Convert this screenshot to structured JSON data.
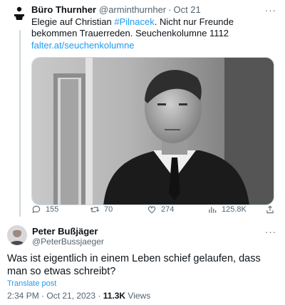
{
  "quoted_tweet": {
    "author_name": "Büro Thurnher",
    "handle": "@arminthurnher",
    "separator": "·",
    "time": "Oct 21",
    "more_label": "···",
    "text_before": "Elegie auf Christian ",
    "hashtag": "#Pilnacek",
    "text_after": ". Nicht nur Freunde bekommen Trauerreden. Seuchenkolumne 1112",
    "link": "falter.at/seuchenkolumne",
    "stats": {
      "replies": "155",
      "retweets": "70",
      "likes": "274",
      "views": "125.8K"
    }
  },
  "main_tweet": {
    "author_name": "Peter Bußjäger",
    "handle": "@PeterBussjaeger",
    "more_label": "···",
    "text": "Was ist eigentlich in einem Leben schief gelaufen, dass man so etwas schreibt?",
    "translate_label": "Translate post",
    "timestamp": "2:34 PM · Oct 21, 2023 · ",
    "views_count": "11.3K",
    "views_label": " Views"
  },
  "colors": {
    "accent": "#1d9bf0",
    "secondary_text": "#536471",
    "primary_text": "#0f1419",
    "divider": "#cfd9de"
  }
}
